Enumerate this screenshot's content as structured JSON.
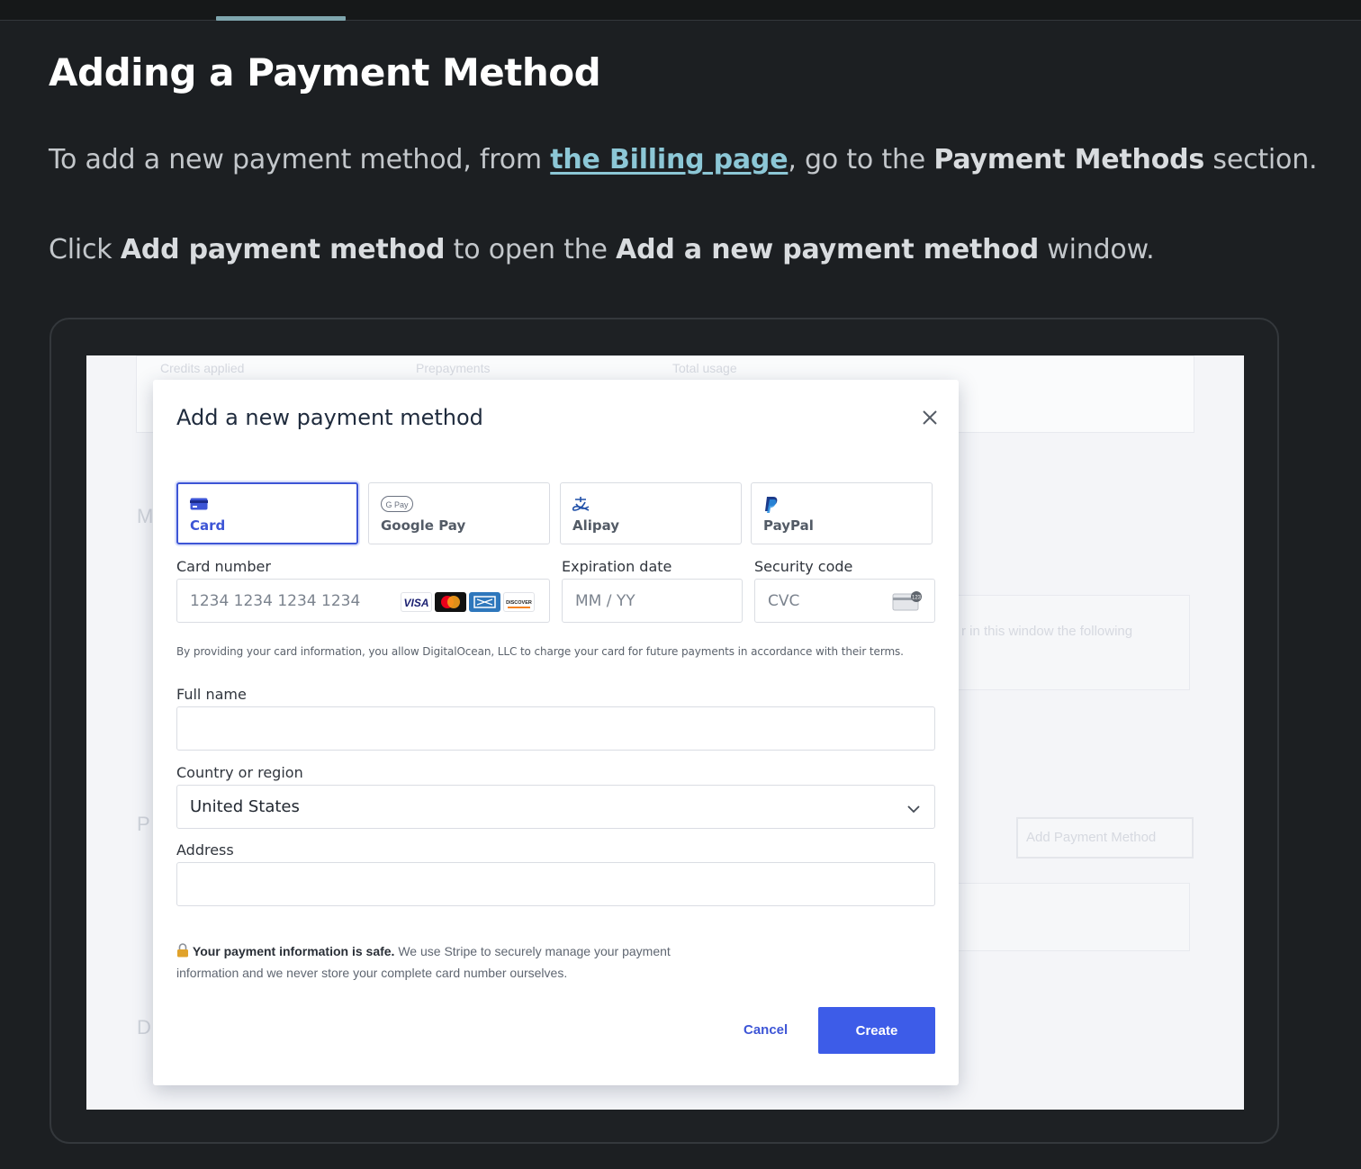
{
  "page": {
    "title": "Adding a Payment Method",
    "para1": {
      "before": "To add a new payment method, from ",
      "link": "the Billing page",
      "middle": ", go to the ",
      "bold": "Payment Methods",
      "after": " section."
    },
    "para2": {
      "before": "Click ",
      "bold1": "Add payment method",
      "middle": " to open the ",
      "bold2": "Add a new payment method",
      "after": " window."
    }
  },
  "background": {
    "credits_applied": "Credits applied",
    "prepayments": "Prepayments",
    "total_usage": "Total usage",
    "window_text": "r in this window the following",
    "add_payment_button": "Add Payment Method",
    "frag_m": "M",
    "frag_p": "P",
    "frag_d": "D"
  },
  "modal": {
    "title": "Add a new payment method",
    "tabs": [
      {
        "label": "Card",
        "icon": "card-icon",
        "active": true
      },
      {
        "label": "Google Pay",
        "icon": "google-pay-icon",
        "active": false
      },
      {
        "label": "Alipay",
        "icon": "alipay-icon",
        "active": false
      },
      {
        "label": "PayPal",
        "icon": "paypal-icon",
        "active": false
      }
    ],
    "card_number_label": "Card number",
    "card_number_placeholder": "1234 1234 1234 1234",
    "card_brands": [
      "VISA",
      "Mastercard",
      "Amex",
      "DISCOVER"
    ],
    "expiration_label": "Expiration date",
    "expiration_placeholder": "MM / YY",
    "security_label": "Security code",
    "security_placeholder": "CVC",
    "notice": "By providing your card information, you allow DigitalOcean, LLC to charge your card for future payments in accordance with their terms.",
    "full_name_label": "Full name",
    "full_name_value": "",
    "country_label": "Country or region",
    "country_value": "United States",
    "address_label": "Address",
    "address_value": "",
    "safe_bold": "Your payment information is safe.",
    "safe_text_1": " We use Stripe to securely manage your payment",
    "safe_text_2": "information and we never store your complete card number ourselves.",
    "cancel_label": "Cancel",
    "create_label": "Create"
  },
  "colors": {
    "accent": "#3d55d6",
    "create_button": "#3d5ce8",
    "link": "#8cc7d6",
    "page_bg": "#1c1f22"
  }
}
